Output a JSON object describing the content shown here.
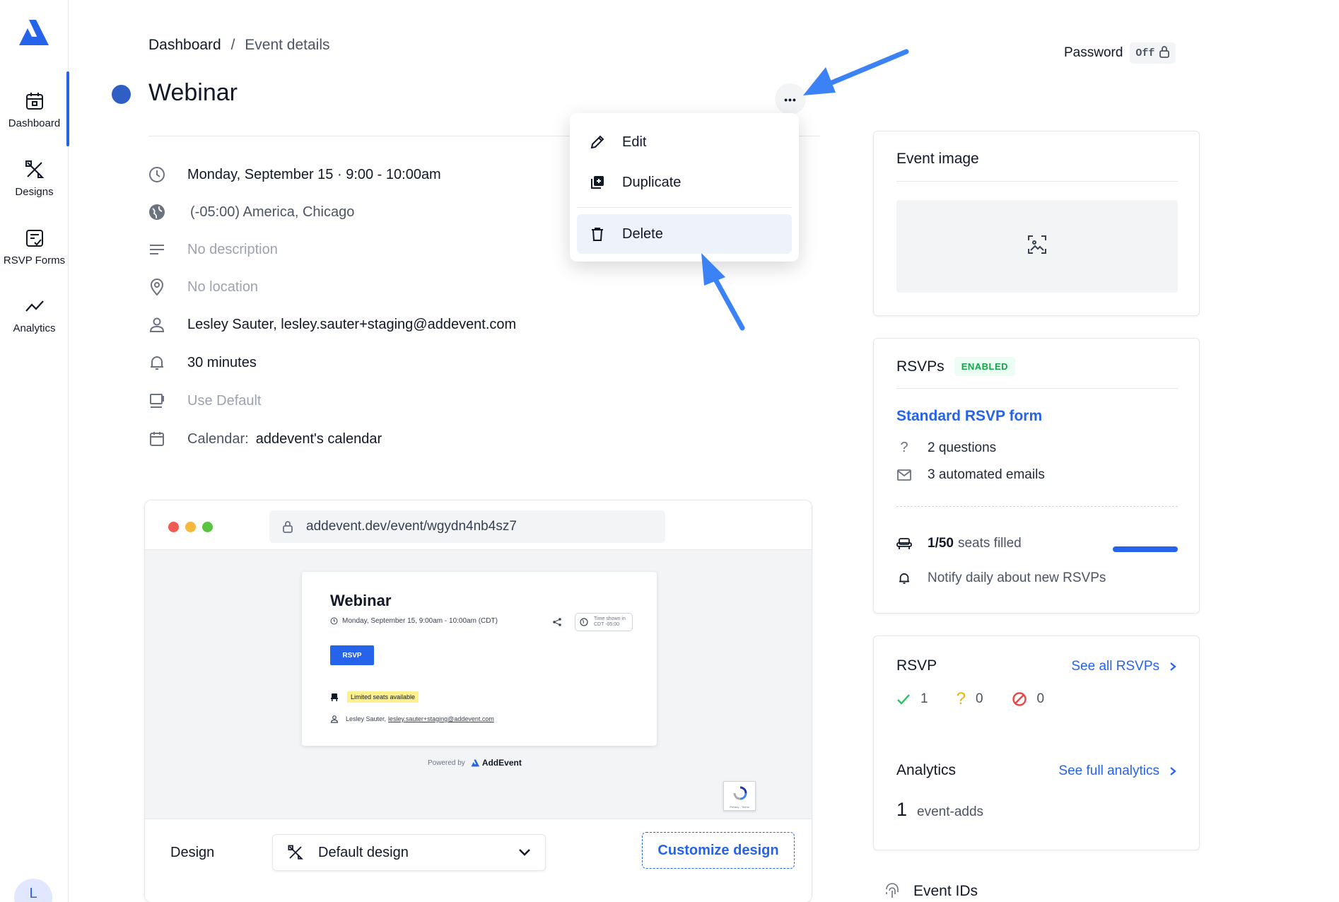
{
  "sidebar": {
    "logo": "addevent-logo",
    "items": [
      {
        "label": "Dashboard",
        "icon": "calendar-icon",
        "active": true
      },
      {
        "label": "Designs",
        "icon": "design-tools-icon"
      },
      {
        "label": "RSVP Forms",
        "icon": "form-check-icon"
      },
      {
        "label": "Analytics",
        "icon": "trend-line-icon"
      }
    ],
    "avatar_initial": "L"
  },
  "breadcrumb": {
    "root": "Dashboard",
    "sep": "/",
    "current": "Event details"
  },
  "password": {
    "label": "Password",
    "state": "Off"
  },
  "event": {
    "title": "Webinar",
    "color": "#2f5fc4",
    "more_label": "•••",
    "datetime": "Monday, September 15 · 9:00 - 10:00am",
    "timezone": "(-05:00) America, Chicago",
    "description": "No description",
    "location": "No location",
    "organizer": "Lesley Sauter, lesley.sauter+staging@addevent.com",
    "reminder": "30 minutes",
    "template": "Use Default",
    "calendar_label": "Calendar:",
    "calendar_value": "addevent's calendar"
  },
  "menu": {
    "items": [
      {
        "label": "Edit",
        "icon": "pencil-icon"
      },
      {
        "label": "Duplicate",
        "icon": "duplicate-icon"
      },
      {
        "label": "Delete",
        "icon": "trash-icon",
        "highlighted": true
      }
    ]
  },
  "preview": {
    "url": "addevent.dev/event/wgydn4nb4sz7",
    "title": "Webinar",
    "datetime": "Monday, September 15, 9:00am - 10:00am (CDT)",
    "tz_line1": "Time shown in",
    "tz_line2": "CDT -05:00",
    "rsvp_button": "RSVP",
    "seats_badge": "Limited seats available",
    "organizer_prefix": "Lesley Sauter,",
    "organizer_email": "lesley.sauter+staging@addevent.com",
    "powered_by": "Powered by",
    "brand": "AddEvent",
    "captcha_text": "Privacy - Terms"
  },
  "design": {
    "label": "Design",
    "selected": "Default design",
    "customize_button": "Customize design"
  },
  "event_image": {
    "title": "Event image"
  },
  "rsvps_card": {
    "title": "RSVPs",
    "badge": "ENABLED",
    "form_link": "Standard RSVP form",
    "questions": "2 questions",
    "emails": "3 automated emails",
    "seats_count": "1/50",
    "seats_suffix": "seats filled",
    "seats_fill_fraction": 0.02,
    "notify": "Notify daily about new RSVPs"
  },
  "rsvp_summary": {
    "title": "RSVP",
    "see_all": "See all RSVPs",
    "yes": "1",
    "maybe": "0",
    "no": "0",
    "colors": {
      "yes": "#22c55e",
      "maybe": "#eab308",
      "no": "#ef4444"
    }
  },
  "analytics": {
    "title": "Analytics",
    "see_full": "See full analytics",
    "count": "1",
    "count_label": "event-adds"
  },
  "event_ids": {
    "title": "Event IDs"
  },
  "colors": {
    "accent": "#2563eb",
    "annotation_arrow": "#3b82f6"
  }
}
